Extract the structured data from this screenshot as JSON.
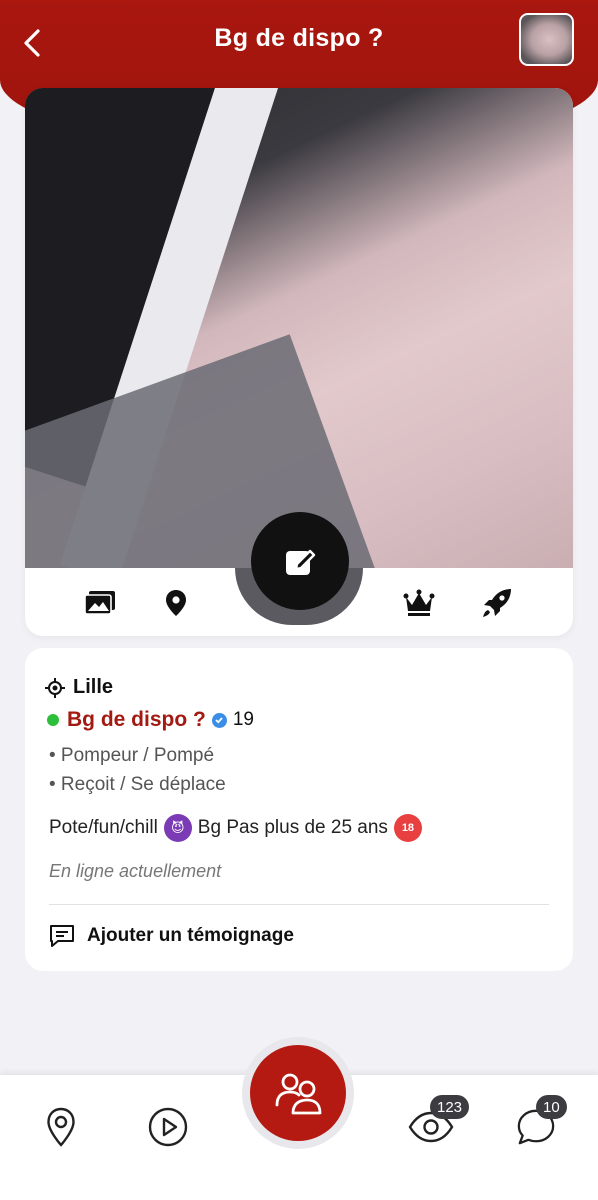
{
  "header": {
    "title": "Bg de dispo ?",
    "back_icon": "chevron-left-icon",
    "bg_color": "#a31a12"
  },
  "profile_actions": {
    "edit_icon": "edit-icon",
    "items": [
      {
        "icon": "photos-icon"
      },
      {
        "icon": "map-pin-icon"
      },
      {
        "icon": "crown-icon"
      },
      {
        "icon": "rocket-icon"
      }
    ]
  },
  "info": {
    "city": "Lille",
    "name": "Bg de dispo ?",
    "age": "19",
    "tags": [
      "• Pompeur / Pompé",
      "• Reçoit / Se déplace"
    ],
    "bio_part1": "Pote/fun/chill",
    "bio_part2": "Bg Pas plus de 25 ans",
    "status": "En ligne actuellement",
    "testimony_label": "Ajouter un témoignage",
    "online_color": "#2dbf3a"
  },
  "tabbar": {
    "items": [
      {
        "icon": "map-pin-icon"
      },
      {
        "icon": "play-icon"
      },
      {
        "icon": "users-icon"
      },
      {
        "icon": "eye-icon",
        "badge": "123"
      },
      {
        "icon": "chat-icon",
        "badge": "10"
      }
    ]
  }
}
